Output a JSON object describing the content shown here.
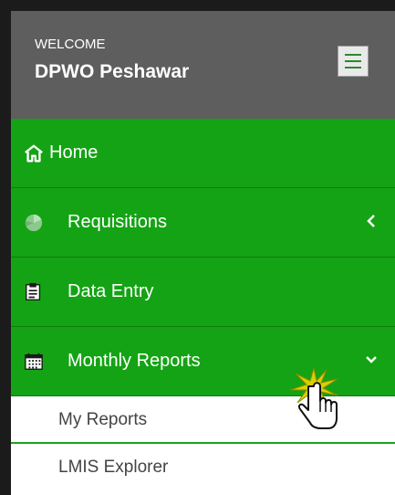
{
  "header": {
    "welcome_label": "WELCOME",
    "username": "DPWO Peshawar"
  },
  "nav": {
    "items": [
      {
        "label": "Home",
        "icon": "home-icon"
      },
      {
        "label": "Requisitions",
        "icon": "pie-chart-icon",
        "chevron": "chevron-left-icon"
      },
      {
        "label": "Data Entry",
        "icon": "document-icon"
      },
      {
        "label": "Monthly Reports",
        "icon": "calendar-icon",
        "chevron": "chevron-down-icon",
        "expanded": true
      }
    ],
    "submenu": [
      {
        "label": "My Reports"
      },
      {
        "label": "LMIS Explorer"
      }
    ]
  },
  "colors": {
    "header_bg": "#5e5e5e",
    "nav_green": "#14a314",
    "divider_green": "#0f7d0f",
    "submenu_bg": "#ffffff",
    "submenu_text": "#444444",
    "click_burst": "#d9d000"
  }
}
